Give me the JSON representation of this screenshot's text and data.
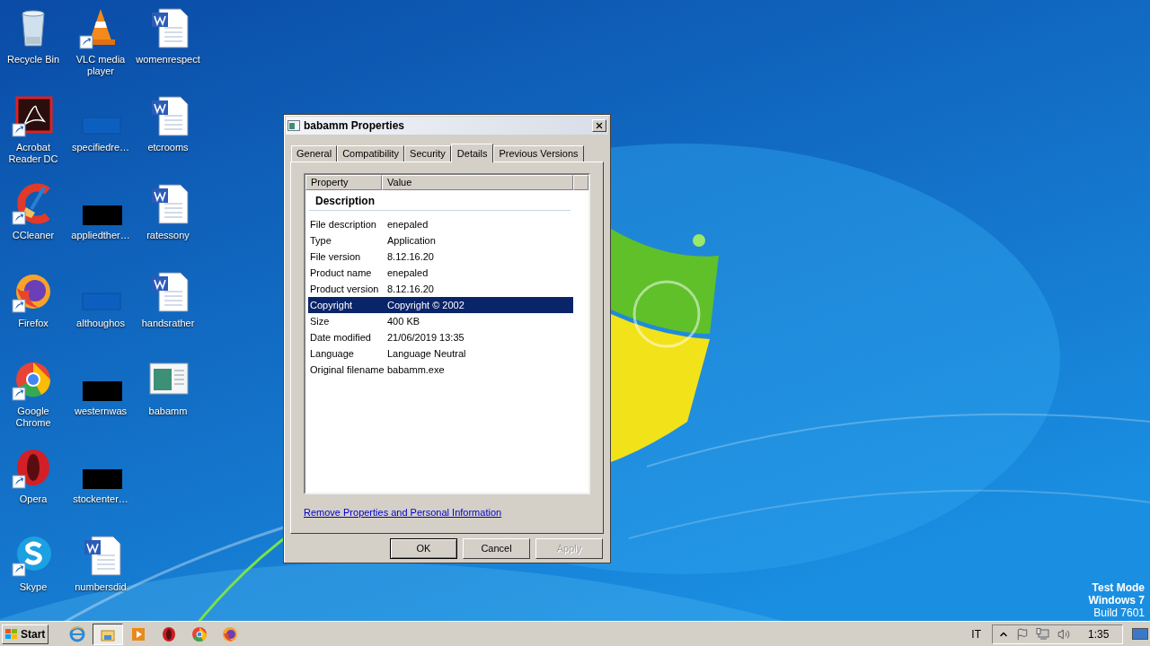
{
  "desktop": {
    "icons": [
      {
        "label": "Recycle Bin",
        "kind": "recycle",
        "shortcut": false
      },
      {
        "label": "Acrobat Reader DC",
        "kind": "acrobat",
        "shortcut": true
      },
      {
        "label": "CCleaner",
        "kind": "ccleaner",
        "shortcut": true
      },
      {
        "label": "Firefox",
        "kind": "firefox",
        "shortcut": true
      },
      {
        "label": "Google Chrome",
        "kind": "chrome",
        "shortcut": true
      },
      {
        "label": "Opera",
        "kind": "opera",
        "shortcut": true
      },
      {
        "label": "Skype",
        "kind": "skype",
        "shortcut": true
      },
      {
        "label": "VLC media player",
        "kind": "vlc",
        "shortcut": true
      },
      {
        "label": "specifiedre…",
        "kind": "blank",
        "shortcut": false
      },
      {
        "label": "appliedther…",
        "kind": "black",
        "shortcut": false
      },
      {
        "label": "althoughos",
        "kind": "blank",
        "shortcut": false
      },
      {
        "label": "westernwas",
        "kind": "black",
        "shortcut": false
      },
      {
        "label": "stockenter…",
        "kind": "black",
        "shortcut": false
      },
      {
        "label": "numbersdid",
        "kind": "word",
        "shortcut": false
      },
      {
        "label": "womenrespect",
        "kind": "word",
        "shortcut": false
      },
      {
        "label": "etcrooms",
        "kind": "word",
        "shortcut": false
      },
      {
        "label": "ratessony",
        "kind": "word",
        "shortcut": false
      },
      {
        "label": "handsrather",
        "kind": "word",
        "shortcut": false
      },
      {
        "label": "babamm",
        "kind": "app",
        "shortcut": false
      }
    ]
  },
  "system_notice": [
    "Test Mode",
    "Windows 7",
    "Build 7601"
  ],
  "dialog": {
    "title": "babamm Properties",
    "tabs": [
      {
        "label": "General",
        "selected": false
      },
      {
        "label": "Compatibility",
        "selected": false
      },
      {
        "label": "Security",
        "selected": false
      },
      {
        "label": "Details",
        "selected": true
      },
      {
        "label": "Previous Versions",
        "selected": false
      }
    ],
    "columns": [
      "Property",
      "Value"
    ],
    "group": "Description",
    "rows": [
      {
        "property": "File description",
        "value": "enepaled",
        "selected": false
      },
      {
        "property": "Type",
        "value": "Application",
        "selected": false
      },
      {
        "property": "File version",
        "value": "8.12.16.20",
        "selected": false
      },
      {
        "property": "Product name",
        "value": "enepaled",
        "selected": false
      },
      {
        "property": "Product version",
        "value": "8.12.16.20",
        "selected": false
      },
      {
        "property": "Copyright",
        "value": "Copyright © 2002",
        "selected": true
      },
      {
        "property": "Size",
        "value": "400 KB",
        "selected": false
      },
      {
        "property": "Date modified",
        "value": "21/06/2019 13:35",
        "selected": false
      },
      {
        "property": "Language",
        "value": "Language Neutral",
        "selected": false
      },
      {
        "property": "Original filename",
        "value": "babamm.exe",
        "selected": false
      }
    ],
    "link": "Remove Properties and Personal Information",
    "buttons": [
      {
        "label": "OK",
        "default": true,
        "disabled": false
      },
      {
        "label": "Cancel",
        "default": false,
        "disabled": false
      },
      {
        "label": "Apply",
        "default": false,
        "disabled": true
      }
    ]
  },
  "taskbar": {
    "start": "Start",
    "apps": [
      {
        "kind": "ie",
        "selected": false
      },
      {
        "kind": "explorer",
        "selected": true
      },
      {
        "kind": "media",
        "selected": false
      },
      {
        "kind": "opera",
        "selected": false
      },
      {
        "kind": "chrome",
        "selected": false
      },
      {
        "kind": "firefox",
        "selected": false
      }
    ],
    "language": "IT",
    "clock": "1:35"
  }
}
